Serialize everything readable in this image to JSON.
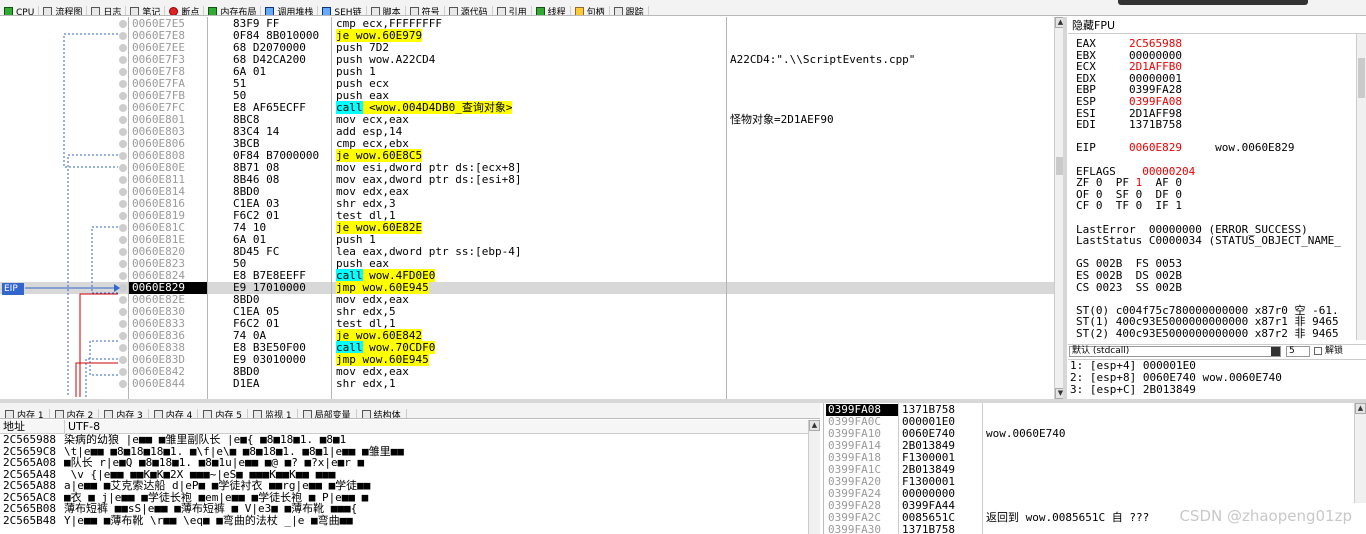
{
  "toolbar": {
    "tabs": [
      {
        "label": "CPU",
        "icon": "cpu-icon",
        "tone": "grn"
      },
      {
        "label": "流程图",
        "icon": "flowchart-icon",
        "tone": ""
      },
      {
        "label": "日志",
        "icon": "log-icon",
        "tone": ""
      },
      {
        "label": "笔记",
        "icon": "notes-icon",
        "tone": ""
      },
      {
        "label": "断点",
        "icon": "breakpoint-icon",
        "tone": "red"
      },
      {
        "label": "内存布局",
        "icon": "memory-map-icon",
        "tone": "grn"
      },
      {
        "label": "调用堆栈",
        "icon": "call-stack-icon",
        "tone": "blu"
      },
      {
        "label": "SEH链",
        "icon": "seh-icon",
        "tone": "blu"
      },
      {
        "label": "脚本",
        "icon": "script-icon",
        "tone": ""
      },
      {
        "label": "符号",
        "icon": "symbol-icon",
        "tone": ""
      },
      {
        "label": "源代码",
        "icon": "source-icon",
        "tone": ""
      },
      {
        "label": "引用",
        "icon": "search-icon",
        "tone": ""
      },
      {
        "label": "线程",
        "icon": "thread-icon",
        "tone": "grn"
      },
      {
        "label": "句柄",
        "icon": "handle-icon",
        "tone": "yel"
      },
      {
        "label": "跟踪",
        "icon": "trace-icon",
        "tone": ""
      }
    ]
  },
  "disasm": {
    "eip_label": "EIP",
    "rows": [
      {
        "addr": "0060E7E5",
        "hex": "83F9 FF",
        "ins": "cmp ecx,FFFFFFFF",
        "hl": "",
        "cmt": ""
      },
      {
        "addr": "0060E7E8",
        "hex": "0F84 8B010000",
        "ins": "je wow.60E979",
        "hl": "y",
        "cmt": ""
      },
      {
        "addr": "0060E7EE",
        "hex": "68 D2070000",
        "ins": "push 7D2",
        "hl": "",
        "cmt": ""
      },
      {
        "addr": "0060E7F3",
        "hex": "68 D42CA200",
        "ins": "push wow.A22CD4",
        "hl": "",
        "cmt": "A22CD4:\".\\\\ScriptEvents.cpp\""
      },
      {
        "addr": "0060E7F8",
        "hex": "6A 01",
        "ins": "push 1",
        "hl": "",
        "cmt": ""
      },
      {
        "addr": "0060E7FA",
        "hex": "51",
        "ins": "push ecx",
        "hl": "",
        "cmt": ""
      },
      {
        "addr": "0060E7FB",
        "hex": "50",
        "ins": "push eax",
        "hl": "",
        "cmt": ""
      },
      {
        "addr": "0060E7FC",
        "hex": "E8 AF65ECFF",
        "ins": "call <wow.004D4DB0_查询对象>",
        "hl": "c",
        "cmt": ""
      },
      {
        "addr": "0060E801",
        "hex": "8BC8",
        "ins": "mov ecx,eax",
        "hl": "",
        "cmt": "怪物对象=2D1AEF90"
      },
      {
        "addr": "0060E803",
        "hex": "83C4 14",
        "ins": "add esp,14",
        "hl": "",
        "cmt": ""
      },
      {
        "addr": "0060E806",
        "hex": "3BCB",
        "ins": "cmp ecx,ebx",
        "hl": "",
        "cmt": ""
      },
      {
        "addr": "0060E808",
        "hex": "0F84 B7000000",
        "ins": "je wow.60E8C5",
        "hl": "y",
        "cmt": ""
      },
      {
        "addr": "0060E80E",
        "hex": "8B71 08",
        "ins": "mov esi,dword ptr ds:[ecx+8]",
        "hl": "",
        "cmt": ""
      },
      {
        "addr": "0060E811",
        "hex": "8B46 08",
        "ins": "mov eax,dword ptr ds:[esi+8]",
        "hl": "",
        "cmt": ""
      },
      {
        "addr": "0060E814",
        "hex": "8BD0",
        "ins": "mov edx,eax",
        "hl": "",
        "cmt": ""
      },
      {
        "addr": "0060E816",
        "hex": "C1EA 03",
        "ins": "shr edx,3",
        "hl": "",
        "cmt": ""
      },
      {
        "addr": "0060E819",
        "hex": "F6C2 01",
        "ins": "test dl,1",
        "hl": "",
        "cmt": ""
      },
      {
        "addr": "0060E81C",
        "hex": "74 10",
        "ins": "je wow.60E82E",
        "hl": "y",
        "cmt": ""
      },
      {
        "addr": "0060E81E",
        "hex": "6A 01",
        "ins": "push 1",
        "hl": "",
        "cmt": ""
      },
      {
        "addr": "0060E820",
        "hex": "8D45 FC",
        "ins": "lea eax,dword ptr ss:[ebp-4]",
        "hl": "",
        "cmt": ""
      },
      {
        "addr": "0060E823",
        "hex": "50",
        "ins": "push eax",
        "hl": "",
        "cmt": ""
      },
      {
        "addr": "0060E824",
        "hex": "E8 B7E8EEFF",
        "ins": "call wow.4FD0E0",
        "hl": "c",
        "cmt": ""
      },
      {
        "addr": "0060E829",
        "hex": "E9 17010000",
        "ins": "jmp wow.60E945",
        "hl": "y",
        "cmt": ""
      },
      {
        "addr": "0060E82E",
        "hex": "8BD0",
        "ins": "mov edx,eax",
        "hl": "",
        "cmt": ""
      },
      {
        "addr": "0060E830",
        "hex": "C1EA 05",
        "ins": "shr edx,5",
        "hl": "",
        "cmt": ""
      },
      {
        "addr": "0060E833",
        "hex": "F6C2 01",
        "ins": "test dl,1",
        "hl": "",
        "cmt": ""
      },
      {
        "addr": "0060E836",
        "hex": "74 0A",
        "ins": "je wow.60E842",
        "hl": "y",
        "cmt": ""
      },
      {
        "addr": "0060E838",
        "hex": "E8 B3E50F00",
        "ins": "call wow.70CDF0",
        "hl": "c",
        "cmt": ""
      },
      {
        "addr": "0060E83D",
        "hex": "E9 03010000",
        "ins": "jmp wow.60E945",
        "hl": "y",
        "cmt": ""
      },
      {
        "addr": "0060E842",
        "hex": "8BD0",
        "ins": "mov edx,eax",
        "hl": "",
        "cmt": ""
      },
      {
        "addr": "0060E844",
        "hex": "D1EA",
        "ins": "shr edx,1",
        "hl": "",
        "cmt": ""
      }
    ]
  },
  "registers": {
    "title": "隐藏FPU",
    "lines": [
      {
        "t": "EAX     ",
        "v": "2C565988",
        "red": true,
        "rest": ""
      },
      {
        "t": "EBX     ",
        "v": "00000000",
        "red": false,
        "rest": ""
      },
      {
        "t": "ECX     ",
        "v": "2D1AFFB0",
        "red": true,
        "rest": ""
      },
      {
        "t": "EDX     ",
        "v": "00000001",
        "red": false,
        "rest": ""
      },
      {
        "t": "EBP     ",
        "v": "0399FA28",
        "red": false,
        "rest": ""
      },
      {
        "t": "ESP     ",
        "v": "0399FA08",
        "red": true,
        "rest": ""
      },
      {
        "t": "ESI     ",
        "v": "2D1AFF98",
        "red": false,
        "rest": ""
      },
      {
        "t": "EDI     ",
        "v": "1371B758",
        "red": false,
        "rest": ""
      },
      {
        "t": "",
        "v": "",
        "red": false,
        "rest": ""
      },
      {
        "t": "EIP     ",
        "v": "0060E829",
        "red": true,
        "rest": "     wow.0060E829"
      },
      {
        "t": "",
        "v": "",
        "red": false,
        "rest": ""
      },
      {
        "t": "EFLAGS    ",
        "v": "00000204",
        "red": true,
        "rest": ""
      },
      {
        "t": "ZF 0  PF ",
        "v": "1",
        "red": true,
        "rest": "  AF 0"
      },
      {
        "t": "OF 0  SF 0  DF 0",
        "v": "",
        "red": false,
        "rest": ""
      },
      {
        "t": "CF 0  TF 0  IF 1",
        "v": "",
        "red": false,
        "rest": ""
      },
      {
        "t": "",
        "v": "",
        "red": false,
        "rest": ""
      },
      {
        "t": "LastError  00000000 (ERROR_SUCCESS)",
        "v": "",
        "red": false,
        "rest": ""
      },
      {
        "t": "LastStatus C0000034 (STATUS_OBJECT_NAME_",
        "v": "",
        "red": false,
        "rest": ""
      },
      {
        "t": "",
        "v": "",
        "red": false,
        "rest": ""
      },
      {
        "t": "GS 002B  FS 0053",
        "v": "",
        "red": false,
        "rest": ""
      },
      {
        "t": "ES 002B  DS 002B",
        "v": "",
        "red": false,
        "rest": ""
      },
      {
        "t": "CS 0023  SS 002B",
        "v": "",
        "red": false,
        "rest": ""
      },
      {
        "t": "",
        "v": "",
        "red": false,
        "rest": ""
      },
      {
        "t": "ST(0) c004f75c780000000000 x87r0 空 -61.",
        "v": "",
        "red": false,
        "rest": ""
      },
      {
        "t": "ST(1) 400c93E5000000000000 x87r1 非 9465",
        "v": "",
        "red": false,
        "rest": ""
      },
      {
        "t": "ST(2) 400c93E5000000000000 x87r2 非 9465",
        "v": "",
        "red": false,
        "rest": ""
      }
    ]
  },
  "stack_header": {
    "convention": "默认 (stdcall)",
    "count": "5",
    "unlock_label": "解锁"
  },
  "arg_hint": [
    "1: [esp+4] 000001E0",
    "2: [esp+8] 0060E740 wow.0060E740",
    "3: [esp+C] 2B013849"
  ],
  "bottom_tabs": [
    {
      "label": "内存 1",
      "icon": "memory-icon"
    },
    {
      "label": "内存 2",
      "icon": "memory-icon"
    },
    {
      "label": "内存 3",
      "icon": "memory-icon"
    },
    {
      "label": "内存 4",
      "icon": "memory-icon"
    },
    {
      "label": "内存 5",
      "icon": "memory-icon"
    },
    {
      "label": "监视 1",
      "icon": "watch-icon"
    },
    {
      "label": "局部变量",
      "icon": "locals-icon"
    },
    {
      "label": "结构体",
      "icon": "struct-icon"
    }
  ],
  "memory": {
    "col_addr": "地址",
    "col_enc": "UTF-8",
    "rows": [
      {
        "a": "2C565988",
        "t": "染病的幼狼 |e■■ ■雏里副队长 |e■{ ■8■18■1. ■8■1"
      },
      {
        "a": "2C5659C8",
        "t": "\\t|e■■ ■8■18■18■1. ■\\f|e\\■ ■8■18■1. ■8■1|e■■ ■雏里■■"
      },
      {
        "a": "2C565A08",
        "t": "■队长 r|e■Q ■8■18■1. ■8■1u|e■■ ■@          ■?  ■?x|e■r ■"
      },
      {
        "a": "2C565A48",
        "t": "             \\v    {|e■■ ■■K■K■2X ■■■~|eS■ ■■■K■■K■■ ■■■"
      },
      {
        "a": "2C565A88",
        "t": "a|e■■ ■艾克索达船 d|eP■ ■学徒衬衣 ■■rg|e■■ ■学徒■■"
      },
      {
        "a": "2C565AC8",
        "t": "■衣 ■  j|e■■ ■学徒长袍 ■em|e■■ ■学徒长袍 ■  P|e■■ ■"
      },
      {
        "a": "2C565B08",
        "t": "薄布短裤 ■■sS|e■■ ■薄布短裤 ■  V|e3■ ■薄布靴    ■■■{"
      },
      {
        "a": "2C565B48",
        "t": "Y|e■■ ■薄布靴 \\r■■  \\eq■ ■弯曲的法杖 _|e    ■弯曲■■"
      }
    ]
  },
  "stack": {
    "rows": [
      {
        "a": "0399FA08",
        "v": "1371B758",
        "c": "",
        "red": false
      },
      {
        "a": "0399FA0C",
        "v": "000001E0",
        "c": "",
        "red": false
      },
      {
        "a": "0399FA10",
        "v": "0060E740",
        "c": "wow.0060E740",
        "red": false
      },
      {
        "a": "0399FA14",
        "v": "2B013849",
        "c": "",
        "red": false
      },
      {
        "a": "0399FA18",
        "v": "F1300001",
        "c": "",
        "red": false
      },
      {
        "a": "0399FA1C",
        "v": "2B013849",
        "c": "",
        "red": false
      },
      {
        "a": "0399FA20",
        "v": "F1300001",
        "c": "",
        "red": false
      },
      {
        "a": "0399FA24",
        "v": "00000000",
        "c": "",
        "red": false
      },
      {
        "a": "0399FA28",
        "v": "0399FA44",
        "c": "",
        "red": false
      },
      {
        "a": "0399FA2C",
        "v": "0085651C",
        "c": "返回到 wow.0085651C 自 ???",
        "red": true
      },
      {
        "a": "0399FA30",
        "v": "1371B758",
        "c": "",
        "red": false
      }
    ]
  },
  "watermark": "CSDN @zhaopeng01zp"
}
